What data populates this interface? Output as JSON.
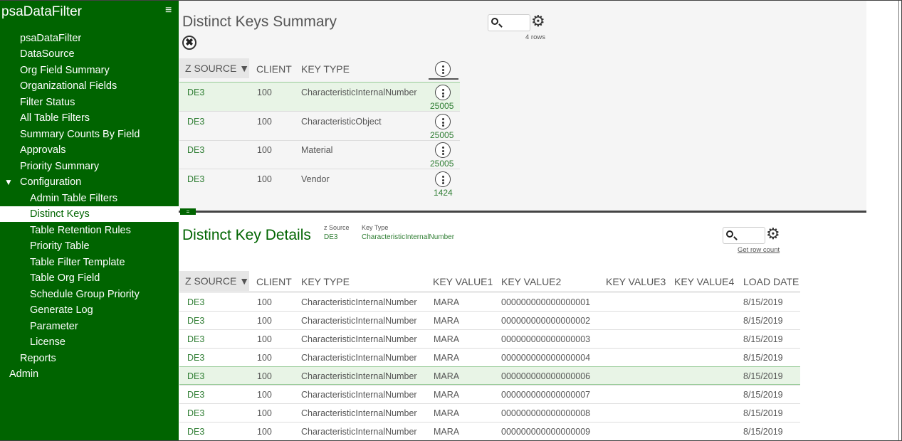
{
  "app": {
    "title": "psaDataFilter",
    "menu_icon": "hamburger-icon"
  },
  "sidebar": {
    "items": [
      {
        "label": "psaDataFilter"
      },
      {
        "label": "DataSource"
      },
      {
        "label": "Org Field Summary"
      },
      {
        "label": "Organizational Fields"
      },
      {
        "label": "Filter Status"
      },
      {
        "label": "All Table Filters"
      },
      {
        "label": "Summary Counts By Field"
      },
      {
        "label": "Approvals"
      },
      {
        "label": "Priority Summary"
      },
      {
        "label": "Configuration",
        "expanded": true
      },
      {
        "label": "Admin Table Filters"
      },
      {
        "label": "Distinct Keys",
        "active": true
      },
      {
        "label": "Table Retention Rules"
      },
      {
        "label": "Priority Table"
      },
      {
        "label": "Table Filter Template"
      },
      {
        "label": "Table Org Field"
      },
      {
        "label": "Schedule Group Priority"
      },
      {
        "label": "Generate Log"
      },
      {
        "label": "Parameter"
      },
      {
        "label": "License"
      },
      {
        "label": "Reports"
      },
      {
        "label": "Admin"
      }
    ],
    "caret": "▼"
  },
  "summary": {
    "title": "Distinct Keys Summary",
    "close_label": "✖",
    "rows_note": "4 rows",
    "search_placeholder": "",
    "gear_glyph": "⚙",
    "columns": [
      "Z SOURCE ▼",
      "CLIENT",
      "KEY TYPE"
    ],
    "rows": [
      {
        "z_source": "DE3",
        "client": "100",
        "key_type": "CharacteristicInternalNumber",
        "count": "25005"
      },
      {
        "z_source": "DE3",
        "client": "100",
        "key_type": "CharacteristicObject",
        "count": "25005"
      },
      {
        "z_source": "DE3",
        "client": "100",
        "key_type": "Material",
        "count": "25005"
      },
      {
        "z_source": "DE3",
        "client": "100",
        "key_type": "Vendor",
        "count": "1424"
      }
    ]
  },
  "divider": {
    "handle_label": "="
  },
  "details": {
    "title": "Distinct Key Details",
    "filters": [
      {
        "label": "z Source",
        "value": "DE3"
      },
      {
        "label": "Key Type",
        "value": "CharacteristicInternalNumber"
      }
    ],
    "row_count_link": "Get row count",
    "search_placeholder": "",
    "gear_glyph": "⚙",
    "columns": [
      "Z SOURCE ▼",
      "CLIENT",
      "KEY TYPE",
      "KEY VALUE1",
      "KEY VALUE2",
      "KEY VALUE3",
      "KEY VALUE4",
      "LOAD DATE"
    ],
    "rows": [
      {
        "z_source": "DE3",
        "client": "100",
        "key_type": "CharacteristicInternalNumber",
        "kv1": "MARA",
        "kv2": "000000000000000001",
        "kv3": "",
        "kv4": "",
        "load_date": "8/15/2019"
      },
      {
        "z_source": "DE3",
        "client": "100",
        "key_type": "CharacteristicInternalNumber",
        "kv1": "MARA",
        "kv2": "000000000000000002",
        "kv3": "",
        "kv4": "",
        "load_date": "8/15/2019"
      },
      {
        "z_source": "DE3",
        "client": "100",
        "key_type": "CharacteristicInternalNumber",
        "kv1": "MARA",
        "kv2": "000000000000000003",
        "kv3": "",
        "kv4": "",
        "load_date": "8/15/2019"
      },
      {
        "z_source": "DE3",
        "client": "100",
        "key_type": "CharacteristicInternalNumber",
        "kv1": "MARA",
        "kv2": "000000000000000004",
        "kv3": "",
        "kv4": "",
        "load_date": "8/15/2019"
      },
      {
        "z_source": "DE3",
        "client": "100",
        "key_type": "CharacteristicInternalNumber",
        "kv1": "MARA",
        "kv2": "000000000000000006",
        "kv3": "",
        "kv4": "",
        "load_date": "8/15/2019"
      },
      {
        "z_source": "DE3",
        "client": "100",
        "key_type": "CharacteristicInternalNumber",
        "kv1": "MARA",
        "kv2": "000000000000000007",
        "kv3": "",
        "kv4": "",
        "load_date": "8/15/2019"
      },
      {
        "z_source": "DE3",
        "client": "100",
        "key_type": "CharacteristicInternalNumber",
        "kv1": "MARA",
        "kv2": "000000000000000008",
        "kv3": "",
        "kv4": "",
        "load_date": "8/15/2019"
      },
      {
        "z_source": "DE3",
        "client": "100",
        "key_type": "CharacteristicInternalNumber",
        "kv1": "MARA",
        "kv2": "000000000000000009",
        "kv3": "",
        "kv4": "",
        "load_date": "8/15/2019"
      }
    ]
  },
  "colors": {
    "brand": "#006400",
    "accent_text": "#2e7d32",
    "row_highlight": "#e8f4e6"
  }
}
